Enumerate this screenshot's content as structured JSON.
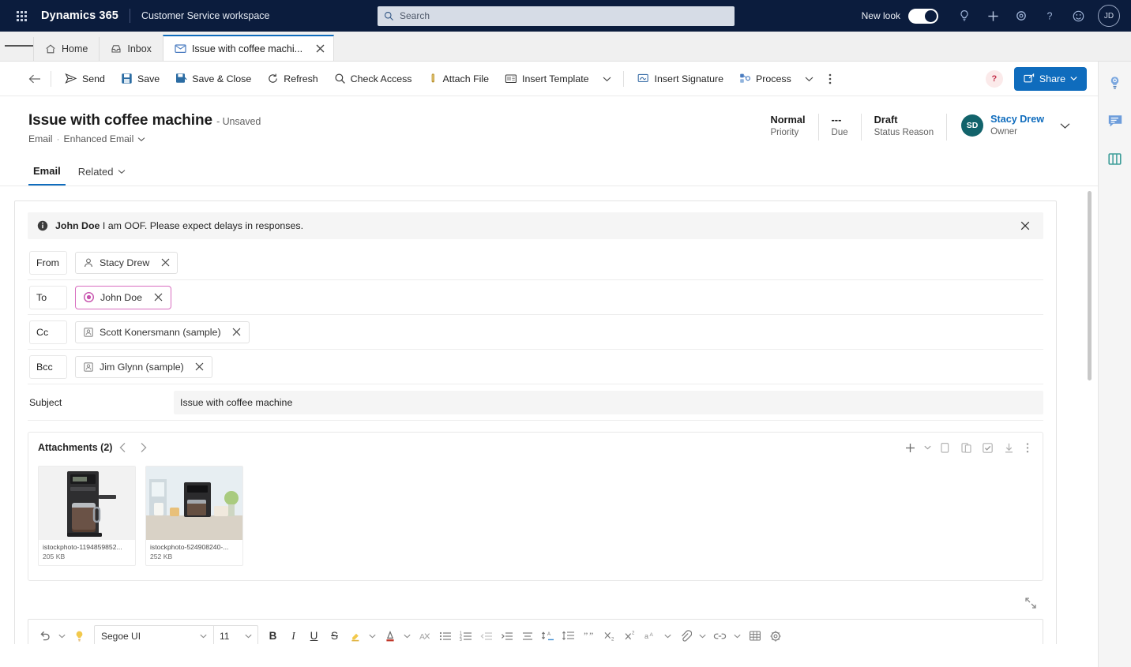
{
  "topnav": {
    "waffle": "app-launcher",
    "brand": "Dynamics 365",
    "app_name": "Customer Service workspace",
    "search_placeholder": "Search",
    "search_value": "",
    "new_look_label": "New look",
    "new_look_on": true,
    "icons": [
      "lightbulb-icon",
      "plus-icon",
      "gear-icon",
      "question-icon",
      "smiley-icon"
    ],
    "avatar_initials": "JD"
  },
  "tabstrip": {
    "tabs": [
      {
        "label": "Home",
        "icon": "home-icon",
        "active": false,
        "closable": false
      },
      {
        "label": "Inbox",
        "icon": "inbox-icon",
        "active": false,
        "closable": false
      },
      {
        "label": "Issue with coffee machi...",
        "icon": "email-icon",
        "active": true,
        "closable": true
      }
    ]
  },
  "commandbar": {
    "back": "back-arrow",
    "buttons": [
      {
        "label": "Send",
        "icon": "send-icon"
      },
      {
        "label": "Save",
        "icon": "save-icon"
      },
      {
        "label": "Save & Close",
        "icon": "save-close-icon"
      },
      {
        "label": "Refresh",
        "icon": "refresh-icon"
      },
      {
        "label": "Check Access",
        "icon": "check-access-icon"
      },
      {
        "label": "Attach File",
        "icon": "attach-file-icon"
      },
      {
        "label": "Insert Template",
        "icon": "insert-template-icon"
      }
    ],
    "buttons2": [
      {
        "label": "Insert Signature",
        "icon": "insert-signature-icon"
      },
      {
        "label": "Process",
        "icon": "process-icon"
      }
    ],
    "overflow": "more-options-icon",
    "help_badge": "?",
    "share_label": "Share"
  },
  "record": {
    "title": "Issue with coffee machine",
    "unsaved": "- Unsaved",
    "entity": "Email",
    "form_name": "Enhanced Email",
    "tabs": [
      {
        "label": "Email",
        "active": true,
        "has_caret": false
      },
      {
        "label": "Related",
        "active": false,
        "has_caret": true
      }
    ],
    "header_fields": [
      {
        "value": "Normal",
        "label": "Priority"
      },
      {
        "value": "---",
        "label": "Due"
      },
      {
        "value": "Draft",
        "label": "Status Reason"
      }
    ],
    "owner": {
      "initials": "SD",
      "name": "Stacy Drew",
      "label": "Owner"
    }
  },
  "notification": {
    "icon": "info-icon",
    "bold_text": "John Doe",
    "text": " I am OOF. Please expect delays in responses.",
    "close": "close-icon"
  },
  "email_form": {
    "rows": [
      {
        "label": "From",
        "boxed_label": true,
        "recipients": [
          {
            "name": "Stacy Drew",
            "icon": "user-icon",
            "focused": false
          }
        ]
      },
      {
        "label": "To",
        "boxed_label": true,
        "recipients": [
          {
            "name": "John Doe",
            "icon": "contact-target-icon",
            "focused": true
          }
        ]
      },
      {
        "label": "Cc",
        "boxed_label": true,
        "recipients": [
          {
            "name": "Scott Konersmann (sample)",
            "icon": "contact-icon",
            "focused": false
          }
        ]
      },
      {
        "label": "Bcc",
        "boxed_label": true,
        "recipients": [
          {
            "name": "Jim Glynn (sample)",
            "icon": "contact-icon",
            "focused": false
          }
        ]
      }
    ],
    "subject": {
      "label": "Subject",
      "value": "Issue with coffee machine"
    }
  },
  "attachments": {
    "title": "Attachments (2)",
    "prev": "chevron-left-icon",
    "next": "chevron-right-icon",
    "tools": [
      "plus-icon",
      "chevron-down-icon",
      "copy-icon",
      "paste-icon",
      "select-all-icon",
      "download-icon",
      "more-options-icon"
    ],
    "items": [
      {
        "filename": "istockphoto-1194859852...",
        "size": "205 KB",
        "thumb": "coffee-maker-photo"
      },
      {
        "filename": "istockphoto-524908240-...",
        "size": "252 KB",
        "thumb": "coffee-machine-kitchen-photo"
      }
    ],
    "expand": "expand-icon"
  },
  "editor_toolbar": {
    "undo": "undo-icon",
    "undo_caret": "chevron-down-icon",
    "ideas": "lightbulb-icon",
    "font_family": "Segoe UI",
    "font_size": "11",
    "buttons": [
      "bold-icon",
      "italic-icon",
      "underline-icon",
      "strikethrough-icon",
      "highlight-icon",
      "highlight-caret-icon",
      "font-color-icon",
      "font-color-caret-icon",
      "clear-formatting-icon",
      "bulleted-list-icon",
      "numbered-list-icon",
      "decrease-indent-icon",
      "increase-indent-icon",
      "align-icon",
      "paragraph-spacing-icon",
      "line-spacing-icon",
      "blockquote-icon",
      "subscript-icon",
      "superscript-icon",
      "text-direction-icon",
      "text-direction-caret-icon",
      "attach-icon",
      "attach-caret-icon",
      "link-icon",
      "link-caret-icon",
      "table-icon",
      "settings-icon"
    ]
  },
  "rail": {
    "icons": [
      "insights-lightbulb-icon",
      "notes-icon",
      "knowledge-book-icon"
    ]
  },
  "colors": {
    "nav_bg": "#0b1c3d",
    "accent": "#0f6cbd",
    "focus_pink": "#d86ec0",
    "avatar_teal": "#12636b",
    "highlight_yellow": "#f2c94c",
    "font_color_red": "#c0392b"
  }
}
